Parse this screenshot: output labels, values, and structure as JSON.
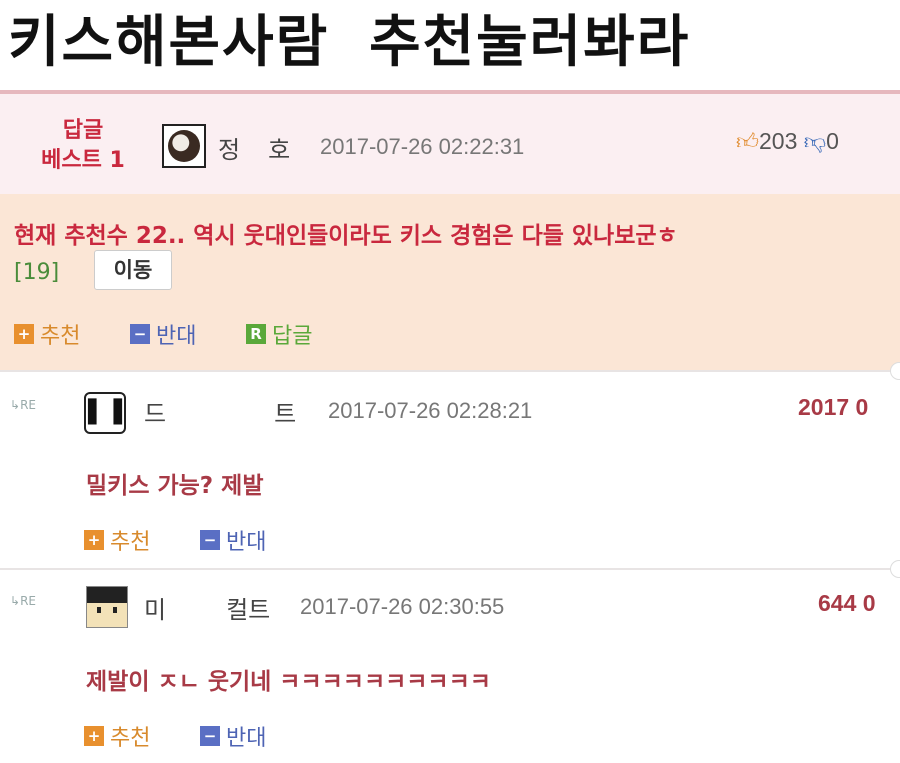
{
  "headline": {
    "left": "키스해본사람",
    "right": "추천눌러봐라"
  },
  "best_reply": {
    "label_line1": "답글",
    "label_line2": "베스트 1",
    "nick_a": "정",
    "nick_b": "호",
    "date": "2017-07-26 02:22:31",
    "upvotes": "203",
    "downvotes": "0",
    "text": "현재 추천수 22.. 역시 웃대인들이라도 키스 경험은 다들 있나보군ㅎ",
    "link_number": "[19]",
    "move_label": "이동",
    "actions": {
      "recommend": "추천",
      "oppose": "반대",
      "reply": "답글"
    }
  },
  "replies": [
    {
      "re": "RE",
      "nick_a": "드",
      "nick_b": "트",
      "date": "2017-07-26 02:28:21",
      "count": "2017 0",
      "text": "밀키스 가능? 제발",
      "actions": {
        "recommend": "추천",
        "oppose": "반대"
      }
    },
    {
      "re": "RE",
      "nick_a": "미",
      "nick_b": "컬트",
      "date": "2017-07-26 02:30:55",
      "count": "644 0",
      "text": "제발이 ㅈㄴ 웃기네 ㅋㅋㅋㅋㅋㅋㅋㅋㅋㅋ",
      "actions": {
        "recommend": "추천",
        "oppose": "반대"
      }
    }
  ],
  "icons": {
    "plus": "+",
    "minus": "−",
    "reply": "R",
    "thumb_up": "👍",
    "thumb_down": "👎"
  },
  "colors": {
    "accent_red": "#c9283e",
    "best_bg": "#fbeff2",
    "best_body_bg": "#fbe6d6"
  }
}
